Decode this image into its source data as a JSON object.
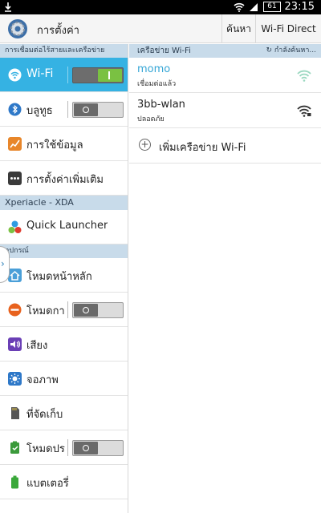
{
  "status_bar": {
    "time": "23:15",
    "battery": "61"
  },
  "action_bar": {
    "title": "การตั้งค่า",
    "search_label": "ค้นหา",
    "wifi_direct_label": "Wi-Fi Direct"
  },
  "left": {
    "header_connections": "การเชื่อมต่อไร้สายและเครือข่าย",
    "wifi_label": "Wi-Fi",
    "wifi_on": true,
    "bluetooth_label": "บลูทูธ",
    "data_usage_label": "การใช้ข้อมูล",
    "more_settings_label": "การตั้งค่าเพิ่มเติม",
    "header_xperiacle": "Xperiacle - XDA",
    "quick_launcher_label": "Quick Launcher",
    "header_device": "อุปกรณ์",
    "home_mode_label": "โหมดหน้าหลัก",
    "blocking_mode_label": "โหมดการ",
    "sound_label": "เสียง",
    "display_label": "จอภาพ",
    "storage_label": "ที่จัดเก็บ",
    "power_saving_label": "โหมดประ",
    "battery_label": "แบตเตอรี่",
    "colors": {
      "accent": "#35b2e3",
      "header_bg": "#c8dbea",
      "toggle_on": "#7ac142"
    }
  },
  "right": {
    "header": "เครือข่าย Wi-Fi",
    "scanning": "กำลังค้นหา...",
    "networks": [
      {
        "name": "momo",
        "status": "เชื่อมต่อแล้ว",
        "connected": true
      },
      {
        "name": "3bb-wlan",
        "status": "ปลอดภัย",
        "connected": false
      }
    ],
    "add_network_label": "เพิ่มเครือข่าย Wi-Fi"
  }
}
